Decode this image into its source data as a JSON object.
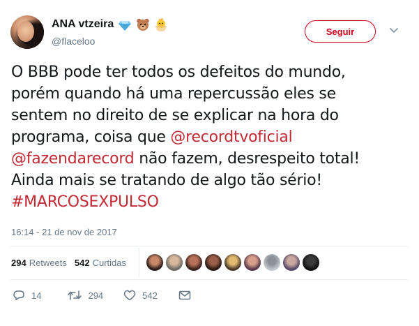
{
  "user": {
    "display_name": "ANA vtzeira",
    "emojis": [
      "gem-icon",
      "bear-face-icon",
      "baby-chick-icon"
    ],
    "handle": "@flaceloo"
  },
  "follow_button": {
    "label": "Seguir"
  },
  "tweet": {
    "lines": [
      [
        {
          "text": "O BBB pode ter todos os defeitos do mundo,",
          "link": false
        }
      ],
      [
        {
          "text": "porém quando há uma repercussão eles se",
          "link": false
        }
      ],
      [
        {
          "text": "sentem no direito de se explicar na hora do",
          "link": false
        }
      ],
      [
        {
          "text": "programa, coisa que ",
          "link": false
        },
        {
          "text": "@recordtvoficial",
          "link": true
        }
      ],
      [
        {
          "text": "@fazendarecord",
          "link": true
        },
        {
          "text": " não fazem, desrespeito total!",
          "link": false
        }
      ],
      [
        {
          "text": "Ainda mais se tratando de algo tão sério!",
          "link": false
        }
      ],
      [
        {
          "text": "#MARCOSEXPULSO",
          "link": true
        }
      ]
    ],
    "timestamp": "16:14 - 21 de nov de 2017",
    "link_color": "#c12a34"
  },
  "stats": {
    "retweets_count": "294",
    "retweets_label": "Retweets",
    "likes_count": "542",
    "likes_label": "Curtidas"
  },
  "likers": [
    {
      "name": "liker-avatar-1",
      "colors": [
        "#2b1d18",
        "#c9876a"
      ]
    },
    {
      "name": "liker-avatar-2",
      "colors": [
        "#6d6a66",
        "#d8b89c"
      ]
    },
    {
      "name": "liker-avatar-3",
      "colors": [
        "#3a231c",
        "#b8705a"
      ]
    },
    {
      "name": "liker-avatar-4",
      "colors": [
        "#2a1a14",
        "#9a5e48"
      ]
    },
    {
      "name": "liker-avatar-5",
      "colors": [
        "#4a3a2a",
        "#e0b870"
      ]
    },
    {
      "name": "liker-avatar-6",
      "colors": [
        "#5a3a4a",
        "#d7a08a"
      ]
    },
    {
      "name": "liker-avatar-7",
      "colors": [
        "#c0c6cc",
        "#8a9299"
      ]
    },
    {
      "name": "liker-avatar-8",
      "colors": [
        "#5a4a6a",
        "#c8a8a0"
      ]
    },
    {
      "name": "liker-avatar-9",
      "colors": [
        "#111111",
        "#3a3a3a"
      ]
    }
  ],
  "actions": {
    "reply_count": "14",
    "retweet_count": "294",
    "like_count": "542",
    "icons": [
      "reply-icon",
      "retweet-icon",
      "like-heart-icon",
      "direct-message-icon"
    ]
  },
  "colors": {
    "accent": "#d0021b",
    "secondary_text": "#657786",
    "divider": "#e6ecf0"
  }
}
